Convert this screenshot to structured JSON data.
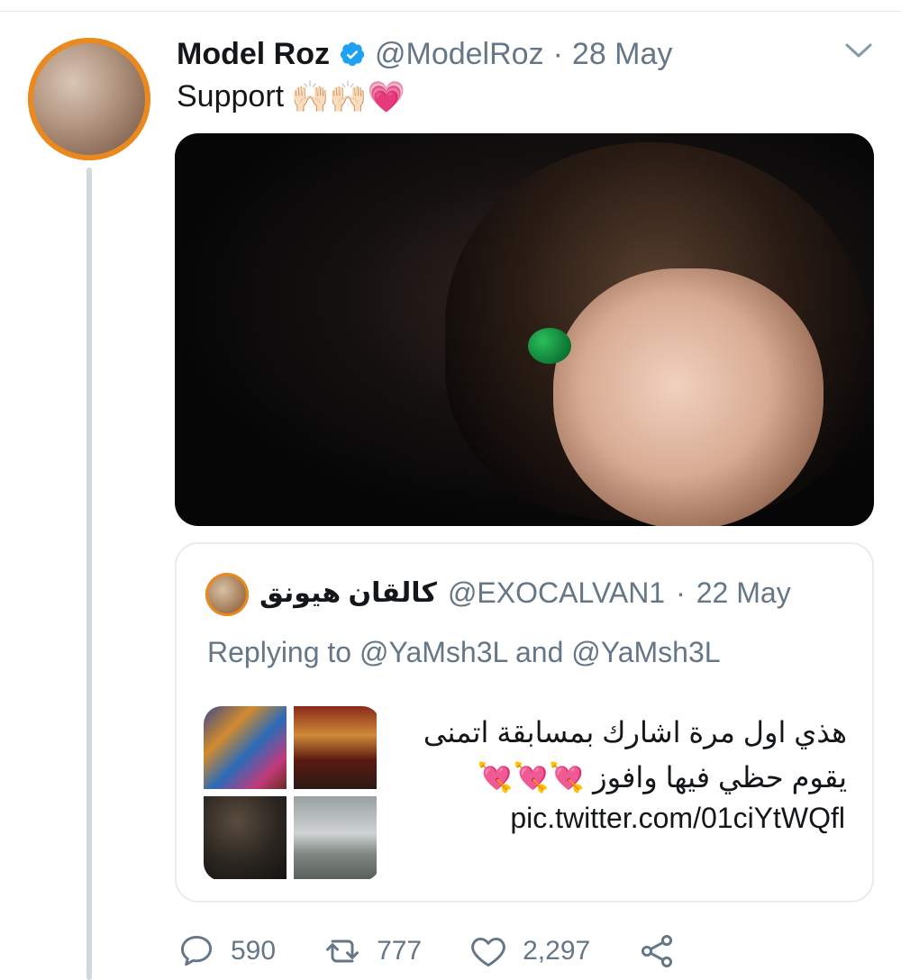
{
  "tweet": {
    "display_name": "Model Roz",
    "handle": "@ModelRoz",
    "separator": "·",
    "date": "28 May",
    "text": "Support",
    "emojis": "🙌🏻🙌🏻💗"
  },
  "quoted": {
    "display_name": "كالقان هيونق",
    "handle": "@EXOCALVAN1",
    "separator": "·",
    "date": "22 May",
    "replying": "Replying to @YaMsh3L and @YaMsh3L",
    "text_line1": "هذي اول مرة اشارك بمسابقة اتمنى",
    "text_line2": "يقوم حظي فيها وافوز 💘💘💘",
    "link": "pic.twitter.com/01ciYtWQfl"
  },
  "actions": {
    "replies": "590",
    "retweets": "777",
    "likes": "2,297"
  },
  "colors": {
    "accent": "#1da1f2",
    "muted": "#657786",
    "avatar_ring": "#e9891e",
    "divider": "#e6ecf0"
  }
}
